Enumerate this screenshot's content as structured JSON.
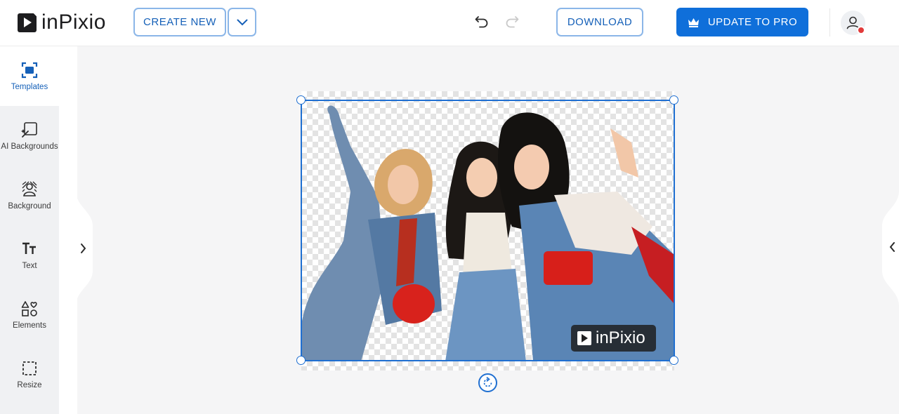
{
  "app": {
    "brand_text": "inPixio"
  },
  "header": {
    "create_new_label": "CREATE NEW",
    "download_label": "DOWNLOAD",
    "upgrade_label": "UPDATE TO PRO"
  },
  "sidebar": {
    "items": [
      {
        "label": "Templates",
        "icon": "templates-icon",
        "active": true
      },
      {
        "label": "AI Backgrounds",
        "icon": "ai-backgrounds-icon",
        "active": false
      },
      {
        "label": "Background",
        "icon": "background-icon",
        "active": false
      },
      {
        "label": "Text",
        "icon": "text-icon",
        "active": false
      },
      {
        "label": "Elements",
        "icon": "elements-icon",
        "active": false
      },
      {
        "label": "Resize",
        "icon": "resize-icon",
        "active": false
      }
    ]
  },
  "canvas": {
    "watermark_text": "inPixio",
    "image_subject": "three women posing, background removed"
  },
  "colors": {
    "accent": "#0f6fda",
    "selection": "#1f6fd1",
    "active_tab_text": "#1560b8",
    "notification_dot": "#e23a3a"
  }
}
